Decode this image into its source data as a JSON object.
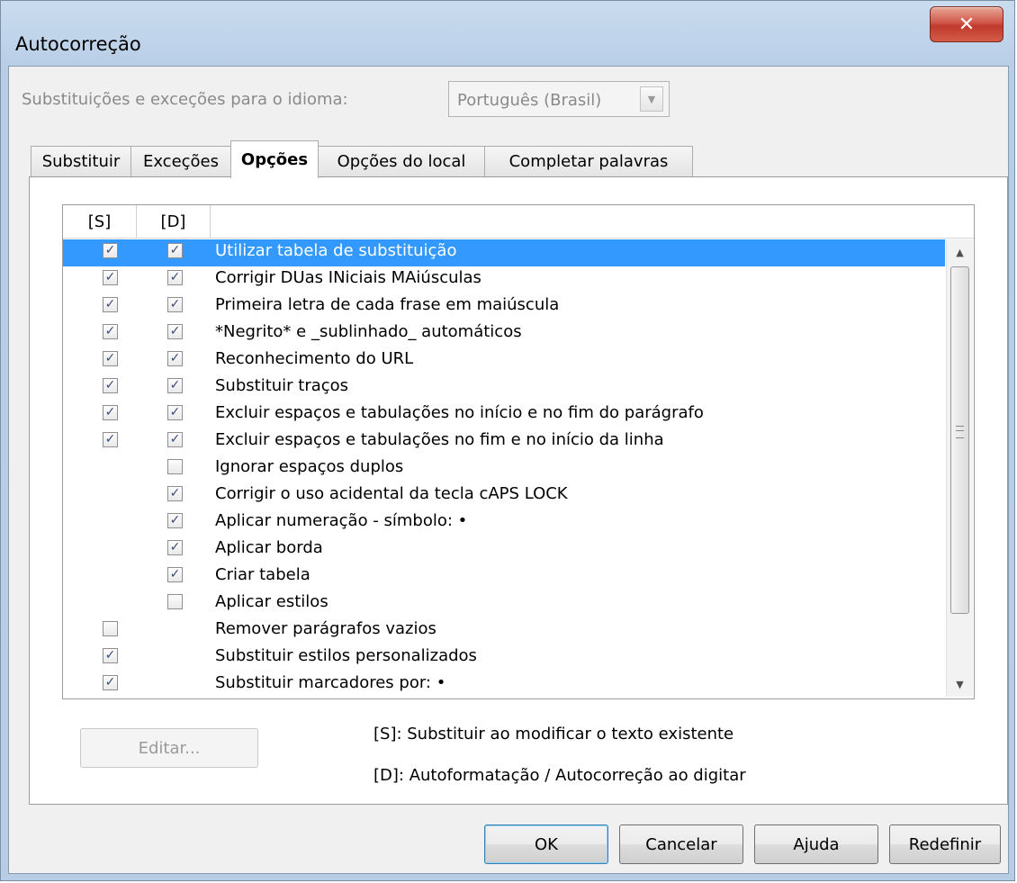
{
  "window": {
    "title": "Autocorreção",
    "close_glyph": "✕"
  },
  "language": {
    "label": "Substituições e exceções para o idioma:",
    "selected": "Português (Brasil)"
  },
  "tabs": [
    {
      "label": "Substituir",
      "active": false
    },
    {
      "label": "Exceções",
      "active": false
    },
    {
      "label": "Opções",
      "active": true
    },
    {
      "label": "Opções do local",
      "active": false
    },
    {
      "label": "Completar palavras",
      "active": false
    }
  ],
  "options_list": {
    "columns": [
      "[S]",
      "[D]",
      ""
    ],
    "rows": [
      {
        "label": "Utilizar tabela de substituição",
        "s": true,
        "d": true,
        "selected": true
      },
      {
        "label": "Corrigir DUas INiciais MAiúsculas",
        "s": true,
        "d": true
      },
      {
        "label": "Primeira letra de cada frase em maiúscula",
        "s": true,
        "d": true
      },
      {
        "label": "*Negrito* e _sublinhado_ automáticos",
        "s": true,
        "d": true
      },
      {
        "label": "Reconhecimento do URL",
        "s": true,
        "d": true
      },
      {
        "label": "Substituir traços",
        "s": true,
        "d": true
      },
      {
        "label": "Excluir espaços e tabulações no início e no fim do parágrafo",
        "s": true,
        "d": true
      },
      {
        "label": "Excluir espaços e tabulações no fim e no início da linha",
        "s": true,
        "d": true
      },
      {
        "label": "Ignorar espaços duplos",
        "s": null,
        "d": false
      },
      {
        "label": "Corrigir o uso acidental da tecla cAPS LOCK",
        "s": null,
        "d": true
      },
      {
        "label": "Aplicar numeração - símbolo: •",
        "s": null,
        "d": true
      },
      {
        "label": "Aplicar borda",
        "s": null,
        "d": true
      },
      {
        "label": "Criar tabela",
        "s": null,
        "d": true
      },
      {
        "label": "Aplicar estilos",
        "s": null,
        "d": false
      },
      {
        "label": "Remover parágrafos vazios",
        "s": false,
        "d": null
      },
      {
        "label": "Substituir estilos personalizados",
        "s": true,
        "d": null
      },
      {
        "label": "Substituir marcadores por: •",
        "s": true,
        "d": null
      }
    ]
  },
  "edit_button": "Editar...",
  "legend": {
    "s": "[S]: Substituir ao modificar o texto existente",
    "d": "[D]: Autoformatação / Autocorreção ao digitar"
  },
  "buttons": {
    "ok": "OK",
    "cancel": "Cancelar",
    "help": "Ajuda",
    "reset": "Redefinir"
  },
  "icons": {
    "check": "✓",
    "arrow_up": "▲",
    "arrow_down": "▼"
  }
}
